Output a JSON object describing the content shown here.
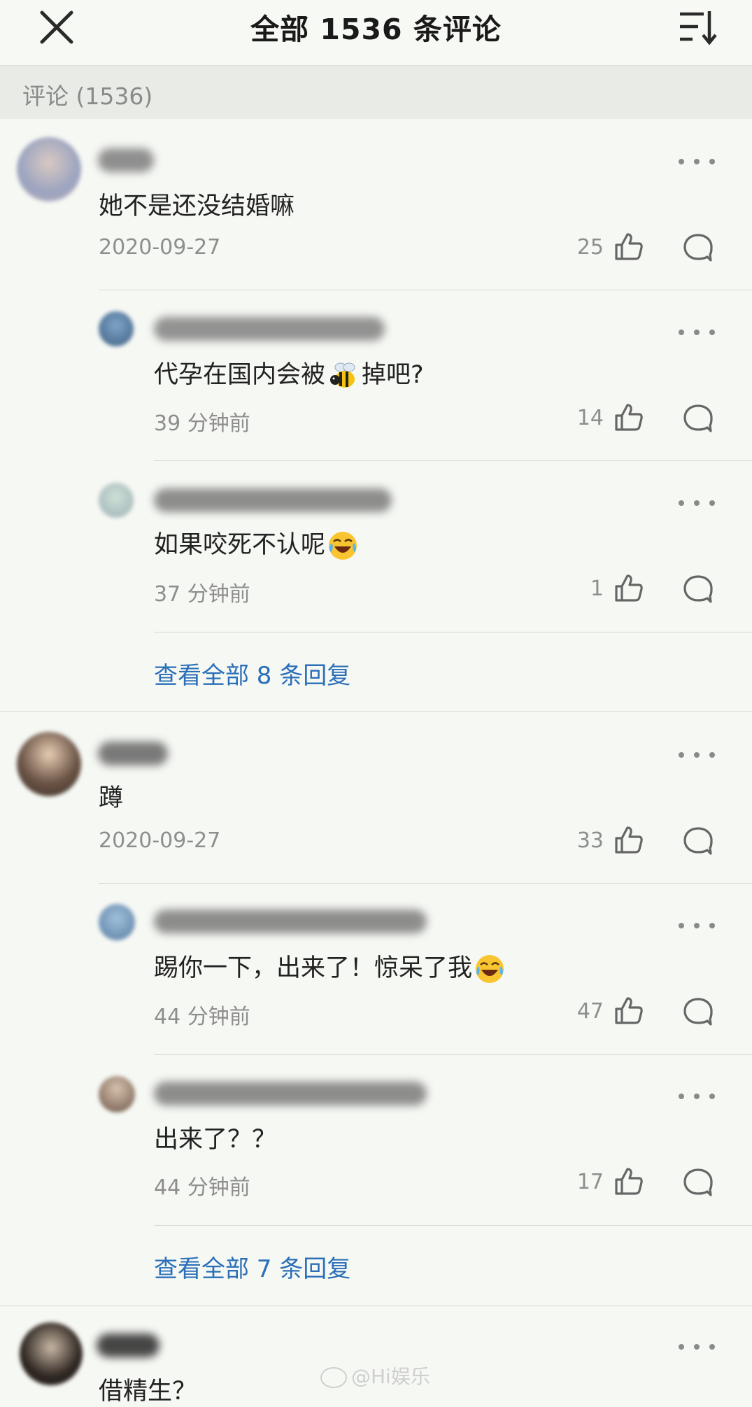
{
  "header": {
    "title": "全部 1536 条评论",
    "close_icon": "close-icon",
    "sort_icon": "sort-icon"
  },
  "section": {
    "label": "评论 (1536)"
  },
  "threads": [
    {
      "comment": {
        "text": "她不是还没结婚嘛",
        "time": "2020-09-27",
        "likes": "25"
      },
      "replies": [
        {
          "text_before": "代孕在国内会被",
          "emoji": "bee-emoji",
          "text_after": "掉吧?",
          "time": "39 分钟前",
          "likes": "14"
        },
        {
          "text_before": "如果咬死不认呢",
          "emoji": "laughing-crying-emoji",
          "text_after": "",
          "time": "37 分钟前",
          "likes": "1"
        }
      ],
      "view_all": "查看全部 8 条回复"
    },
    {
      "comment": {
        "text": "蹲",
        "time": "2020-09-27",
        "likes": "33"
      },
      "replies": [
        {
          "text_before": "踢你一下，出来了！惊呆了我",
          "emoji": "laughing-crying-emoji",
          "text_after": "",
          "time": "44 分钟前",
          "likes": "47"
        },
        {
          "text_before": "出来了？？",
          "emoji": "",
          "text_after": "",
          "time": "44 分钟前",
          "likes": "17"
        }
      ],
      "view_all": "查看全部 7 条回复"
    },
    {
      "comment": {
        "text": "借精生？"
      }
    }
  ],
  "watermark": "@Hi娱乐",
  "colors": {
    "link": "#2a6fb8",
    "meta": "#8e8e8e",
    "background": "#f6f8f4"
  }
}
